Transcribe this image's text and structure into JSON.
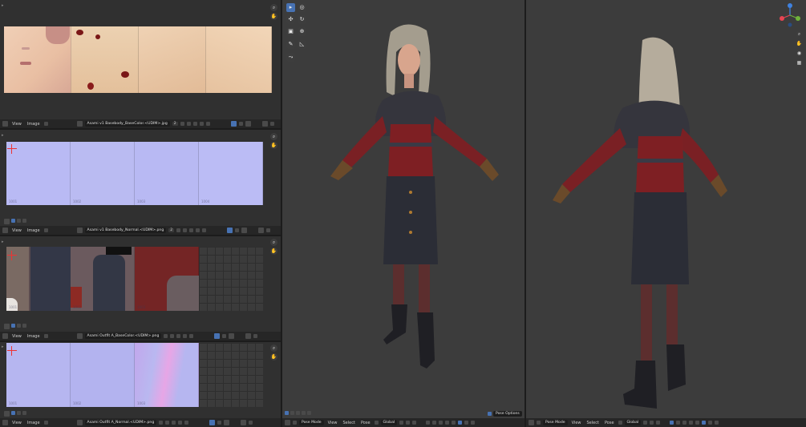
{
  "menus": {
    "view": "View",
    "image": "Image",
    "select": "Select",
    "pose": "Pose"
  },
  "editors": [
    {
      "filename": "Asami v1 Basebody_BaseColor.<UDIM>.jpg",
      "frame": "2",
      "tiles": []
    },
    {
      "filename": "Asami v1 Basebody_Normal.<UDIM>.png",
      "frame": "2",
      "tiles": [
        "1001",
        "1002",
        "1003",
        "1004"
      ]
    },
    {
      "filename": "Asami Outfit A_BaseColor.<UDIM>.png",
      "frame": "",
      "tiles": [
        "1001",
        "1002",
        "1003"
      ]
    },
    {
      "filename": "Asami Outfit A_Normal.<UDIM>.png",
      "frame": "",
      "tiles": [
        "1001",
        "1002",
        "1003"
      ]
    }
  ],
  "viewport_left": {
    "mode": "Pose Mode",
    "orientation": "Global",
    "pose_options": "Pose Options"
  },
  "viewport_right": {
    "mode": "Pose Mode",
    "orientation": "Global"
  },
  "gizmo": {
    "x_color": "#e64452",
    "y_color": "#6fb33a",
    "z_color": "#3f82e0"
  },
  "colors": {
    "accent": "#4772b3",
    "header": "#262626",
    "background": "#303030"
  }
}
